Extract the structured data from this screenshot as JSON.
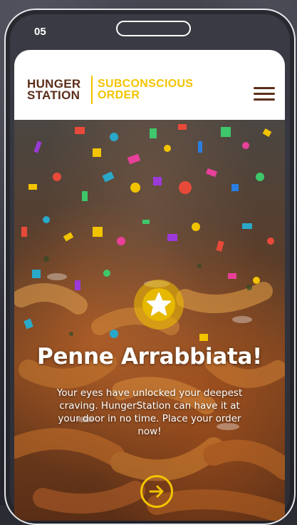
{
  "status_bar": {
    "time": "05"
  },
  "header": {
    "brand_line1": "HUNGER",
    "brand_line2": "STATION",
    "campaign_line1": "SUBCONSCIOUS",
    "campaign_line2": "ORDER",
    "menu_icon": "hamburger-menu-icon"
  },
  "hero": {
    "badge_icon": "star-icon",
    "title": "Penne Arrabbiata!",
    "message": "Your eyes have unlocked your deepest craving. HungerStation can have it at your door in no time. Place your order now!",
    "cta_icon": "arrow-right-circle-icon"
  },
  "colors": {
    "brand_brown": "#5b2e1a",
    "brand_yellow": "#f2c400",
    "header_bg": "#ffffff",
    "text_on_hero": "#ffffff"
  }
}
